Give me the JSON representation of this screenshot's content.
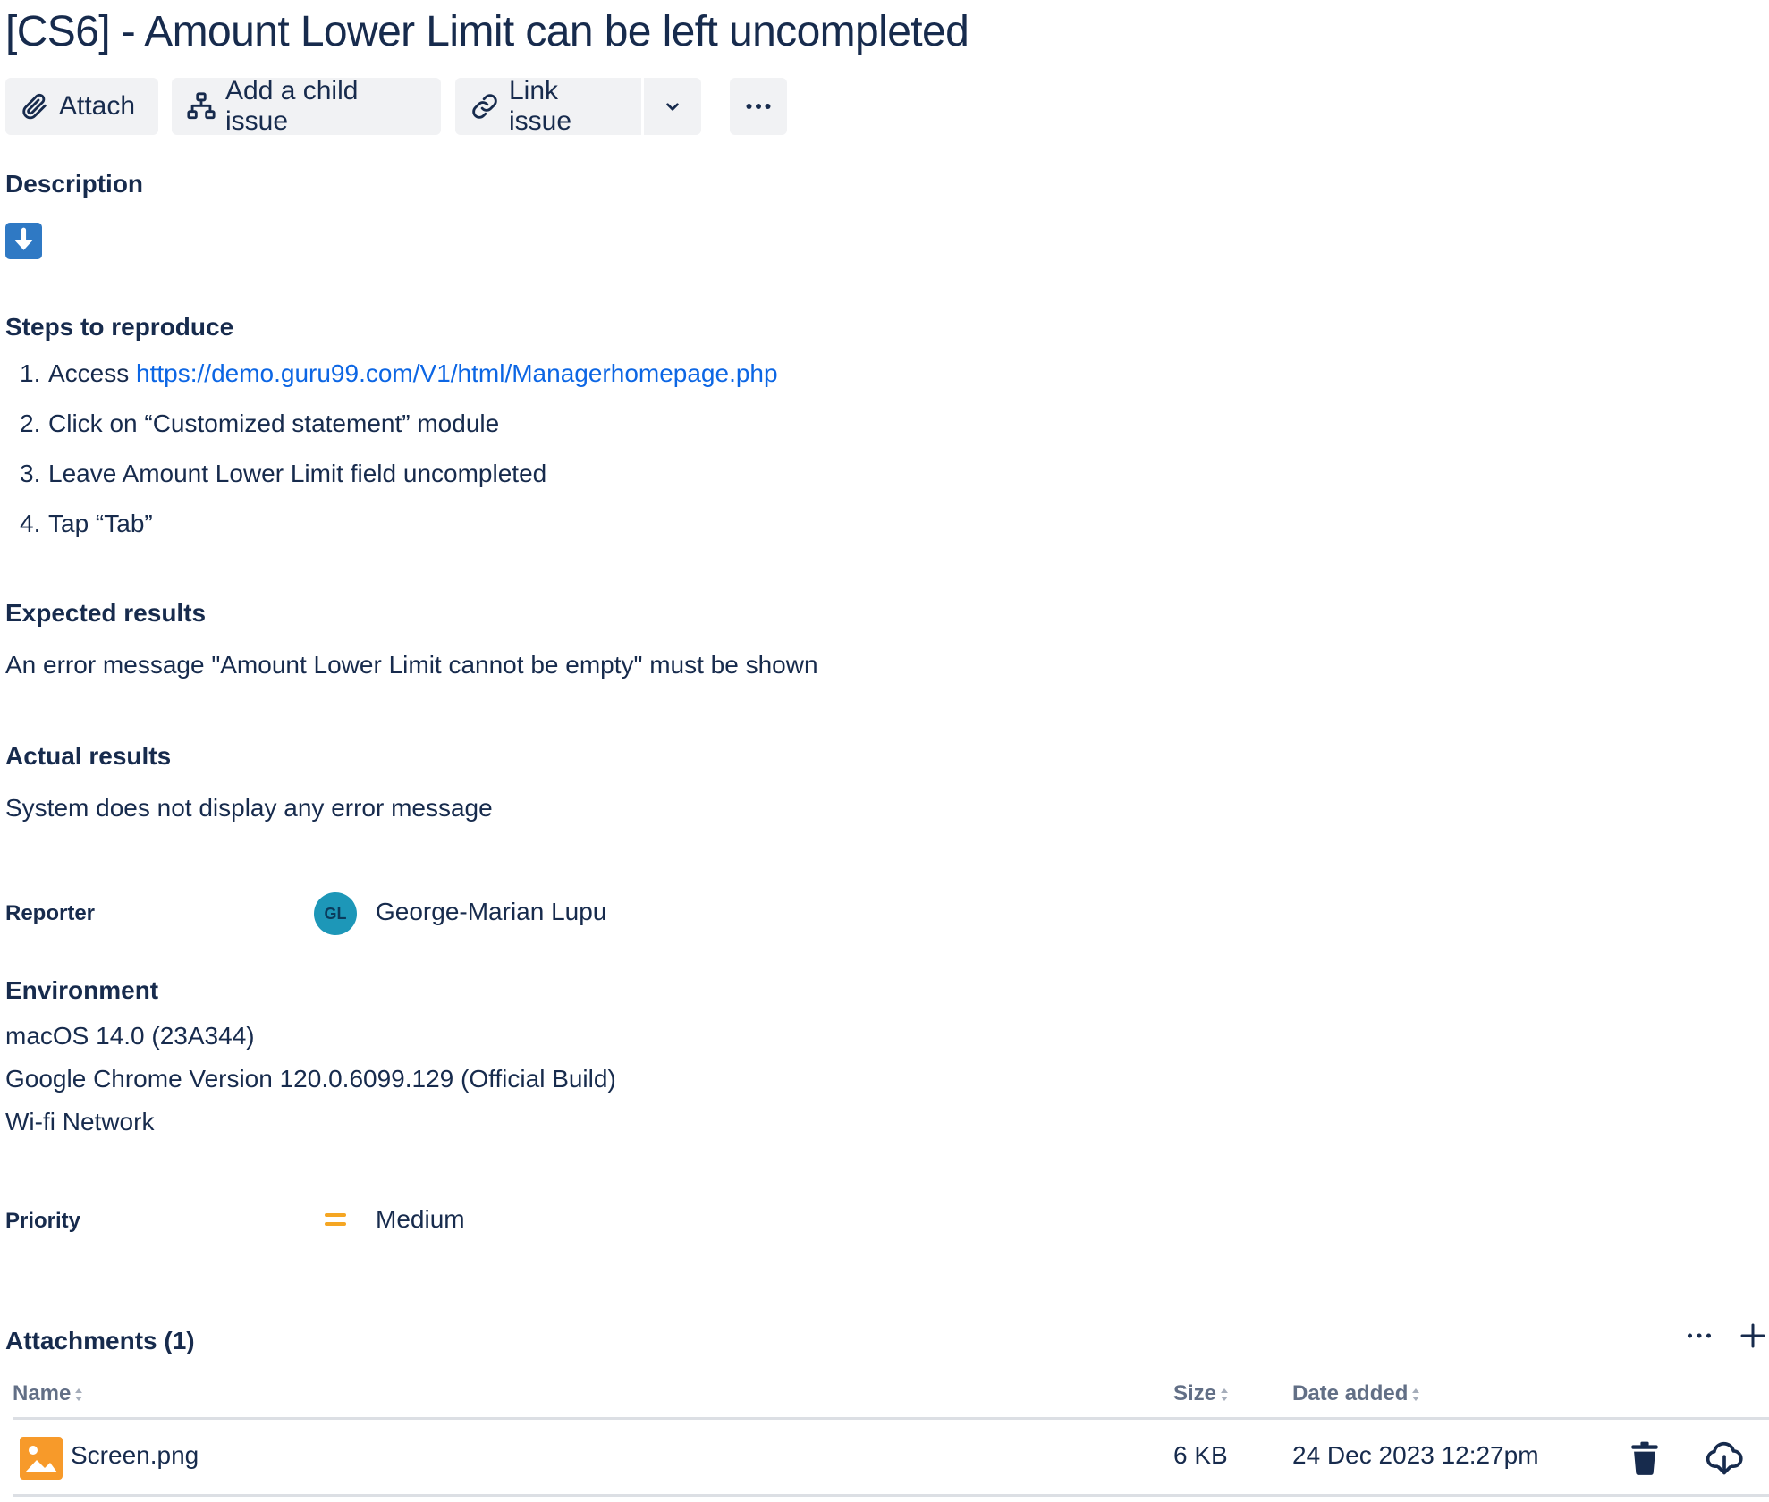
{
  "issue": {
    "title": "[CS6] - Amount Lower Limit can be left uncompleted"
  },
  "toolbar": {
    "attach_label": "Attach",
    "add_child_label": "Add a child issue",
    "link_issue_label": "Link issue"
  },
  "description": {
    "heading": "Description",
    "steps_heading": "Steps to reproduce",
    "steps": [
      {
        "num": "1.",
        "prefix": "Access ",
        "link": "https://demo.guru99.com/V1/html/Managerhomepage.php"
      },
      {
        "num": "2.",
        "text": "Click on “Customized statement” module"
      },
      {
        "num": "3.",
        "text": "Leave Amount Lower Limit field uncompleted"
      },
      {
        "num": "4.",
        "text": "Tap “Tab”"
      }
    ],
    "expected_heading": "Expected results",
    "expected_text": "An error message \"Amount Lower Limit cannot be empty\" must be shown",
    "actual_heading": "Actual results",
    "actual_text": "System does not display any error message"
  },
  "reporter": {
    "label": "Reporter",
    "initials": "GL",
    "name": "George-Marian Lupu",
    "avatar_color": "#1d97b8"
  },
  "environment": {
    "heading": "Environment",
    "lines": [
      "macOS 14.0 (23A344)",
      "Google Chrome Version 120.0.6099.129 (Official Build)",
      "Wi-fi Network"
    ]
  },
  "priority": {
    "label": "Priority",
    "value": "Medium",
    "icon": "priority-medium-icon",
    "color": "#f5a623"
  },
  "attachments": {
    "heading": "Attachments (1)",
    "columns": {
      "name": "Name",
      "size": "Size",
      "date": "Date added"
    },
    "rows": [
      {
        "name": "Screen.png",
        "size": "6 KB",
        "date": "24 Dec 2023 12:27pm"
      }
    ]
  },
  "colors": {
    "text": "#172b4d",
    "link": "#0c66e4",
    "button_bg": "#f1f2f4",
    "muted": "#626f86"
  }
}
